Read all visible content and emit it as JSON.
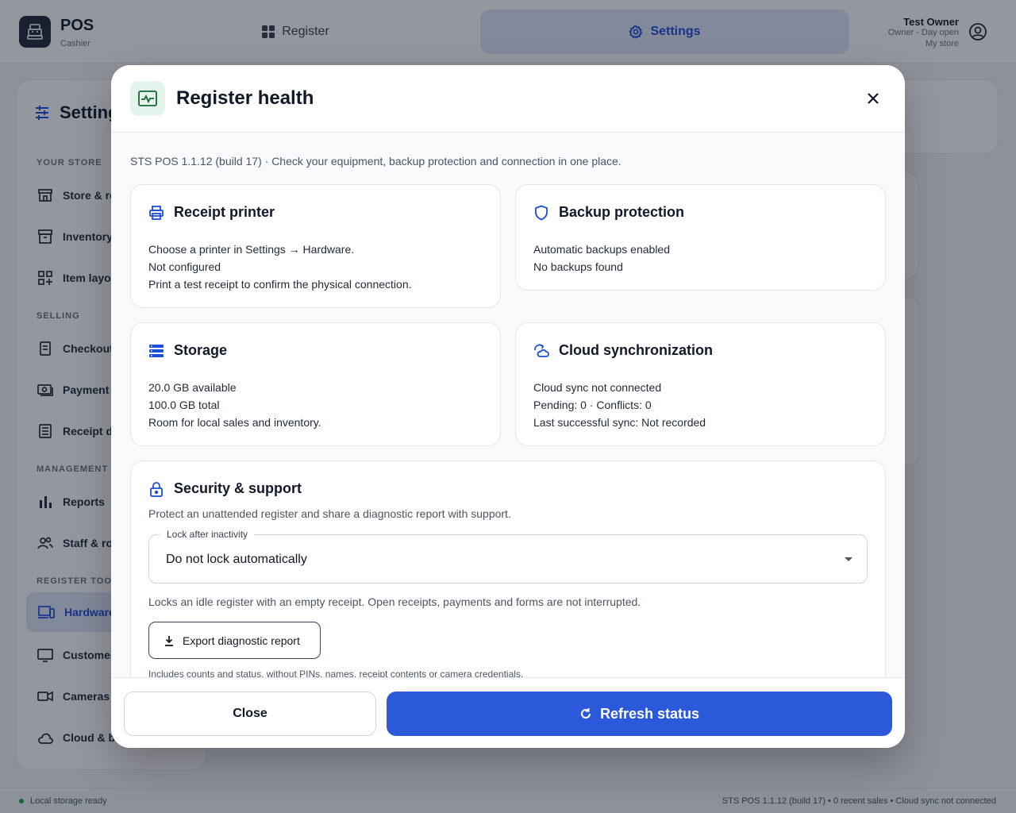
{
  "app": {
    "name": "POS",
    "role": "Cashier"
  },
  "nav": {
    "register": "Register",
    "settings": "Settings"
  },
  "user": {
    "name": "Test Owner",
    "status": "Owner - Day open",
    "store": "My store"
  },
  "sidebar": {
    "title": "Settings",
    "sections": [
      "YOUR STORE",
      "SELLING",
      "MANAGEMENT",
      "REGISTER TOOLS"
    ],
    "items": [
      {
        "label": "Store & receipt",
        "icon": "store-icon"
      },
      {
        "label": "Inventory",
        "icon": "inventory-icon"
      },
      {
        "label": "Item layout",
        "icon": "grid-icon"
      },
      {
        "label": "Checkout",
        "icon": "checkout-icon"
      },
      {
        "label": "Payment methods",
        "icon": "payment-icon"
      },
      {
        "label": "Receipt design",
        "icon": "receipt-icon"
      },
      {
        "label": "Reports",
        "icon": "reports-icon"
      },
      {
        "label": "Staff & roles",
        "icon": "staff-icon"
      },
      {
        "label": "Hardware",
        "icon": "hardware-icon"
      },
      {
        "label": "Customer display",
        "icon": "monitor-icon"
      },
      {
        "label": "Cameras",
        "icon": "camera-icon"
      },
      {
        "label": "Cloud & backups",
        "icon": "cloud-icon"
      }
    ]
  },
  "statusbar": {
    "left": "Local storage ready",
    "right": "STS POS 1.1.12 (build 17)  •  0 recent sales  •  Cloud sync not connected"
  },
  "modal": {
    "title": "Register health",
    "subtitle": "STS POS 1.1.12 (build 17) · Check your equipment, backup protection and connection in one place.",
    "cards": {
      "printer": {
        "title": "Receipt printer",
        "lines": [
          "Choose a printer in Settings → Hardware.",
          "Not configured",
          "Print a test receipt to confirm the physical connection."
        ]
      },
      "backup": {
        "title": "Backup protection",
        "lines": [
          "Automatic backups enabled",
          "No backups found"
        ]
      },
      "storage": {
        "title": "Storage",
        "lines": [
          "20.0 GB available",
          "100.0 GB total",
          "Room for local sales and inventory."
        ]
      },
      "cloud": {
        "title": "Cloud synchronization",
        "lines": [
          "Cloud sync not connected",
          "Pending: 0 · Conflicts: 0",
          "Last successful sync: Not recorded"
        ]
      }
    },
    "security": {
      "title": "Security & support",
      "description": "Protect an unattended register and share a diagnostic report with support.",
      "lock_label": "Lock after inactivity",
      "lock_value": "Do not lock automatically",
      "lock_hint": "Locks an idle register with an empty receipt. Open receipts, payments and forms are not interrupted.",
      "export_label": "Export diagnostic report",
      "export_note": "Includes counts and status, without PINs, names, receipt contents or camera credentials."
    },
    "footer": {
      "close": "Close",
      "refresh": "Refresh status"
    }
  },
  "colors": {
    "accent": "#2b59d9",
    "active_bg": "#dfe5f8",
    "success": "#16a34a"
  }
}
